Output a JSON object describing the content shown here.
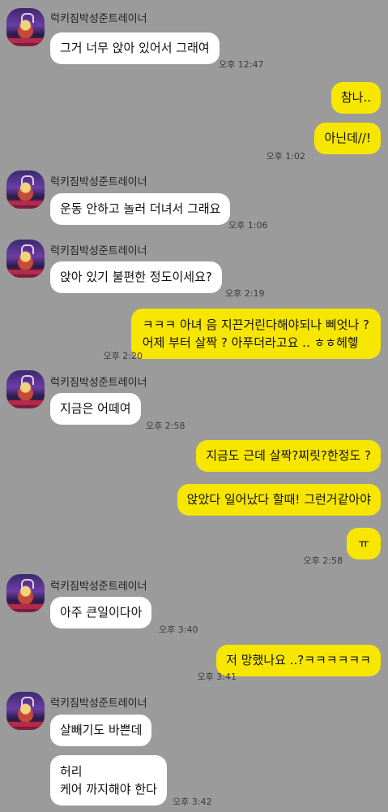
{
  "sender_name": "럭키짐박성준트레이너",
  "messages": [
    {
      "dir": "in",
      "text": "그거 너무 앉아 있어서 그래여",
      "time": "오후 12:47"
    },
    {
      "dir": "out",
      "text": "참나..",
      "time": ""
    },
    {
      "dir": "out",
      "text": "아닌데//!",
      "time": "오후 1:02"
    },
    {
      "dir": "in",
      "text": "운동 안하고 놀러 더녀서 그래요",
      "time": "오후 1:06"
    },
    {
      "dir": "in",
      "text": "앉아 있기 불편한 정도이세요?",
      "time": "오후 2:19"
    },
    {
      "dir": "out",
      "line1": "ㅋㅋㅋ 아녀 음 지끈거린다해야되나 삐엇나 ?",
      "line2": "어제 부터 살짝 ? 아푸더라고요 .. ㅎㅎ헤헿",
      "time": "오후 2:20"
    },
    {
      "dir": "in",
      "text": "지금은 어떼여",
      "time": "오후 2:58"
    },
    {
      "dir": "out",
      "text": "지금도 근데 살짝?찌릿?한정도 ?",
      "time": ""
    },
    {
      "dir": "out",
      "text": "앉았다 일어났다 할때! 그런거같아야",
      "time": ""
    },
    {
      "dir": "out",
      "text": "ㅠ",
      "time": "오후 2:58"
    },
    {
      "dir": "in",
      "text": "아주 큰일이다아",
      "time": "오후 3:40"
    },
    {
      "dir": "out",
      "text": "저 망했나요 ..?ㅋㅋㅋㅋㅋㅋ",
      "time": "오후 3:41"
    },
    {
      "dir": "in",
      "text": "살빼기도 바쁜데",
      "time": ""
    },
    {
      "dir": "in",
      "line1": "허리",
      "line2": "케어 까지해야 한다",
      "time": "오후 3:42"
    }
  ]
}
